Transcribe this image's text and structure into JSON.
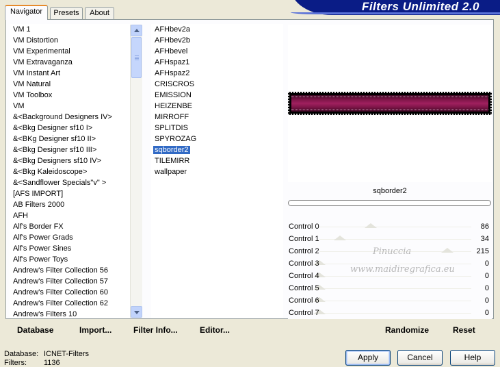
{
  "banner": {
    "title": "Filters Unlimited 2.0"
  },
  "tabs": [
    {
      "label": "Navigator",
      "active": true
    },
    {
      "label": "Presets",
      "active": false
    },
    {
      "label": "About",
      "active": false
    }
  ],
  "categories": [
    "VM 1",
    "VM Distortion",
    "VM Experimental",
    "VM Extravaganza",
    "VM Instant Art",
    "VM Natural",
    "VM Toolbox",
    "VM",
    "&<Background Designers IV>",
    "&<Bkg Designer sf10 I>",
    "&<BKg Designer sf10 II>",
    "&<Bkg Designer sf10 III>",
    "&<Bkg Designers sf10 IV>",
    "&<Bkg Kaleidoscope>",
    "&<Sandflower Specials\"v\" >",
    "[AFS IMPORT]",
    "AB Filters 2000",
    "AFH",
    "Alf's Border FX",
    "Alf's Power Grads",
    "Alf's Power Sines",
    "Alf's Power Toys",
    "Andrew's Filter Collection 56",
    "Andrew's Filter Collection 57",
    "Andrew's Filter Collection 60",
    "Andrew's Filter Collection 62",
    "Andrew's Filters 10"
  ],
  "filters": [
    "AFHbev2a",
    "AFHbev2b",
    "AFHbevel",
    "AFHspaz1",
    "AFHspaz2",
    "CRISCROS",
    "EMISSION",
    "HEIZENBE",
    "MIRROFF",
    "SPLITDIS",
    "SPYROZAG",
    "sqborder2",
    "TILEMIRR",
    "wallpaper"
  ],
  "selected_filter": "sqborder2",
  "controls": [
    {
      "label": "Control 0",
      "value": "86",
      "level": 86
    },
    {
      "label": "Control 1",
      "value": "34",
      "level": 34
    },
    {
      "label": "Control 2",
      "value": "215",
      "level": 215
    },
    {
      "label": "Control 3",
      "value": "0",
      "level": 0
    },
    {
      "label": "Control 4",
      "value": "0",
      "level": 0
    },
    {
      "label": "Control 5",
      "value": "0",
      "level": 0
    },
    {
      "label": "Control 6",
      "value": "0",
      "level": 0
    },
    {
      "label": "Control 7",
      "value": "0",
      "level": 0
    }
  ],
  "watermark": {
    "line1": "Pinuccia",
    "line2": "www.maidiregrafica.eu"
  },
  "toolbar": {
    "database": "Database",
    "import": "Import...",
    "filter_info": "Filter Info...",
    "editor": "Editor...",
    "randomize": "Randomize",
    "reset": "Reset"
  },
  "status": {
    "database_label": "Database:",
    "database_value": "ICNET-Filters",
    "filters_label": "Filters:",
    "filters_value": "1136"
  },
  "buttons": {
    "apply": "Apply",
    "cancel": "Cancel",
    "help": "Help"
  },
  "colors": {
    "selection": "#316ac5",
    "banner": "#0a1c86",
    "accent_tab": "#e68b2c"
  },
  "icons": {
    "scroll_up": "chevron-up-icon",
    "scroll_down": "chevron-down-icon"
  }
}
